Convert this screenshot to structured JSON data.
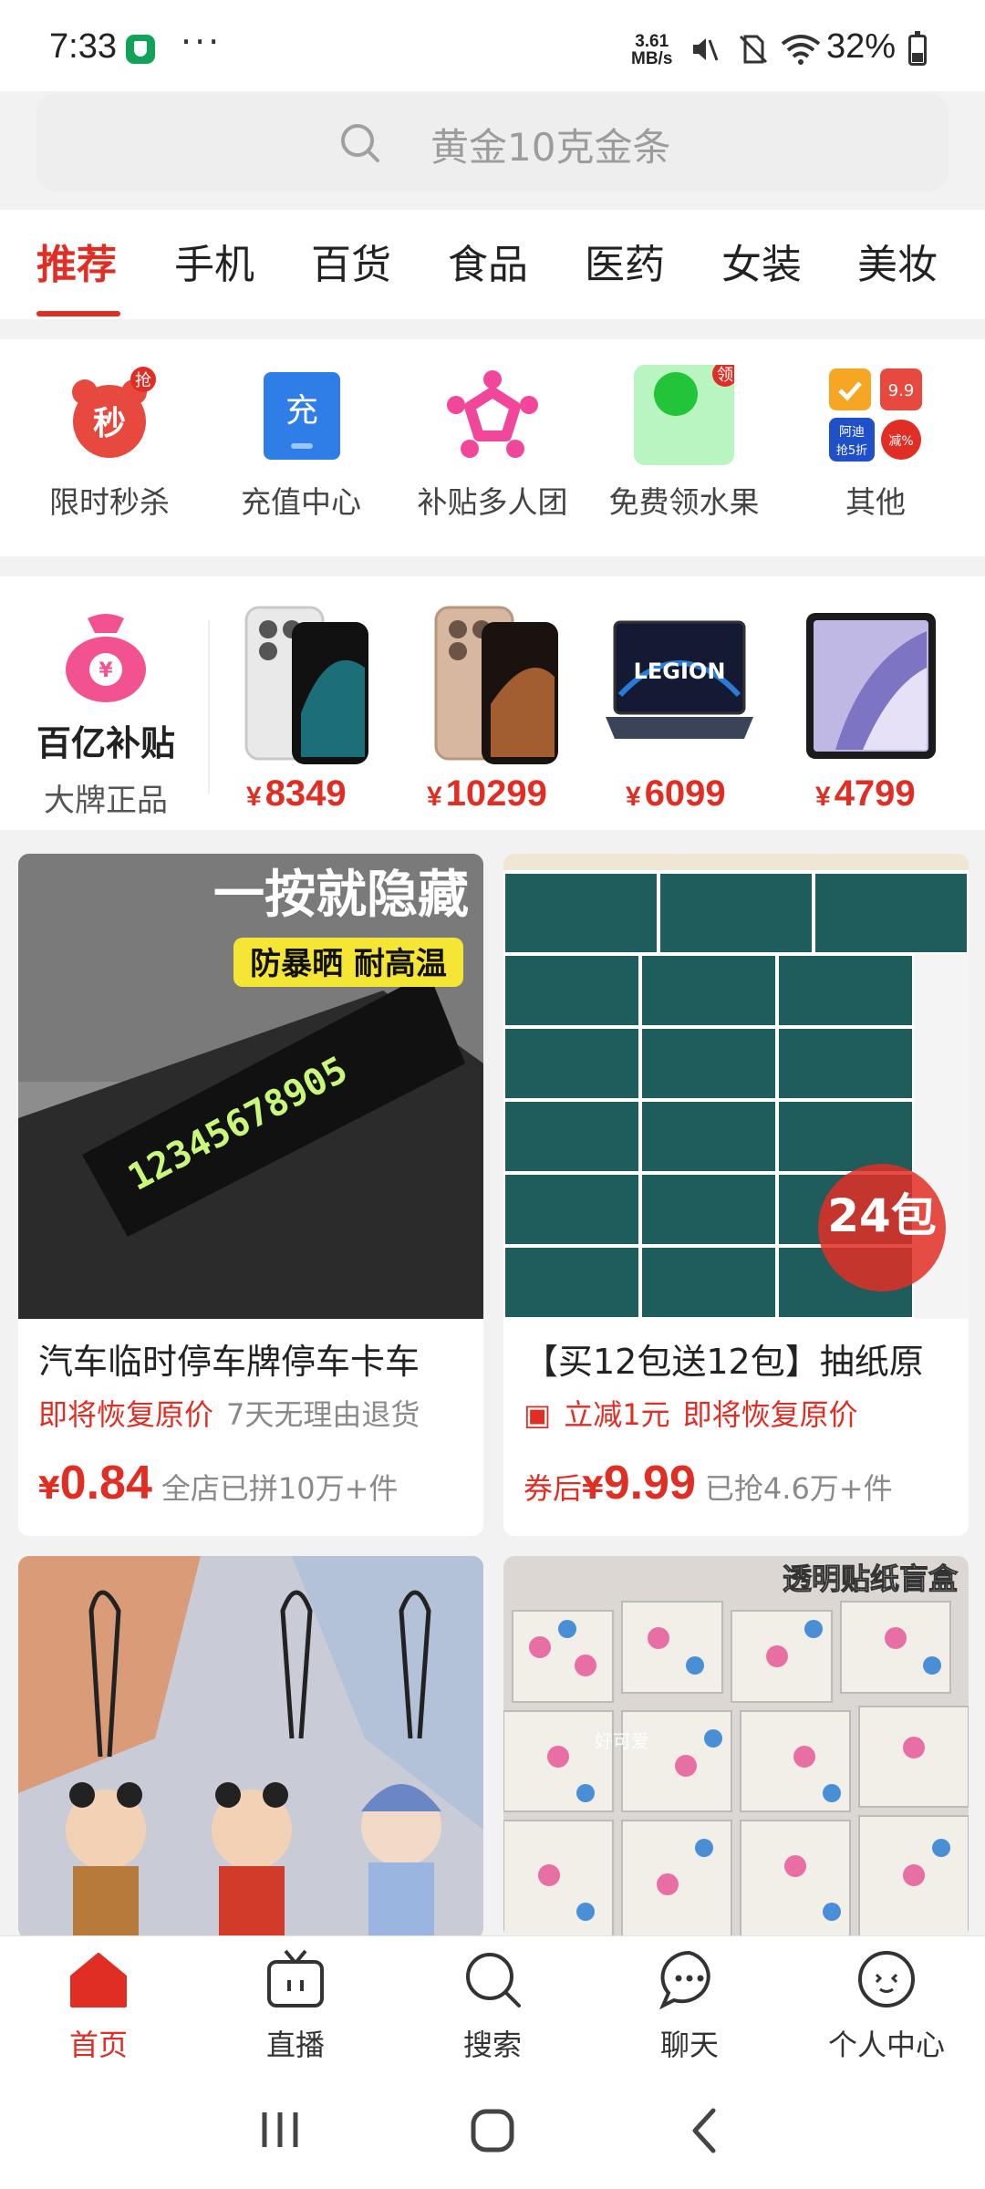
{
  "status_bar": {
    "time": "7:33",
    "net_speed_value": "3.61",
    "net_speed_unit": "MB/s",
    "battery": "32%"
  },
  "search": {
    "placeholder": "黄金10克金条"
  },
  "tabs": [
    "推荐",
    "手机",
    "百货",
    "食品",
    "医药",
    "女装",
    "美妆"
  ],
  "active_tab": "推荐",
  "quick_icons": [
    {
      "label": "限时秒杀",
      "icon": "alarm-clock-icon",
      "badge": "抢",
      "glyph": "秒"
    },
    {
      "label": "充值中心",
      "icon": "recharge-icon",
      "glyph": "充"
    },
    {
      "label": "补贴多人团",
      "icon": "group-icon"
    },
    {
      "label": "免费领水果",
      "icon": "fruit-icon",
      "badge": "领"
    },
    {
      "label": "其他",
      "icon": "more-apps-icon",
      "mini": [
        "阿迪",
        "抢5折",
        "9.9",
        "减%"
      ]
    }
  ],
  "subsidy": {
    "title": "百亿补贴",
    "subtitle": "大牌正品",
    "bag_glyph": "¥",
    "currency": "¥",
    "products": [
      {
        "name": "white-phone",
        "price": "8349"
      },
      {
        "name": "gold-phone",
        "price": "10299"
      },
      {
        "name": "laptop",
        "price": "6099",
        "logo": "LEGION"
      },
      {
        "name": "tablet",
        "price": "4799"
      }
    ]
  },
  "feed": [
    {
      "title": "汽车临时停车牌停车卡车",
      "img_text_1": "一按就隐藏",
      "img_text_2": "防暴晒 耐高温",
      "img_digits": "12345678905",
      "tag1": "即将恢复原价",
      "tag2": "7天无理由退货",
      "price_prefix": "",
      "price": "0.84",
      "sold": "全店已拼10万+件"
    },
    {
      "title": "【买12包送12包】抽纸原",
      "img_badge": "24包",
      "tag1": "立减1元",
      "tag2": "即将恢复原价",
      "price_prefix": "券后",
      "price": "9.99",
      "sold": "已抢4.6万+件"
    },
    {
      "title": "",
      "image": "figure-keychains"
    },
    {
      "title": "",
      "img_text": "透明贴纸盲盒",
      "img_watermark": "好可爱",
      "image": "sticker-boxes"
    }
  ],
  "bottom_nav": [
    {
      "label": "首页",
      "icon": "home-icon",
      "active": true
    },
    {
      "label": "直播",
      "icon": "live-tv-icon"
    },
    {
      "label": "搜索",
      "icon": "search-icon"
    },
    {
      "label": "聊天",
      "icon": "chat-icon"
    },
    {
      "label": "个人中心",
      "icon": "profile-icon"
    }
  ],
  "colors": {
    "accent": "#e02e24",
    "background": "#f2f2f2"
  }
}
